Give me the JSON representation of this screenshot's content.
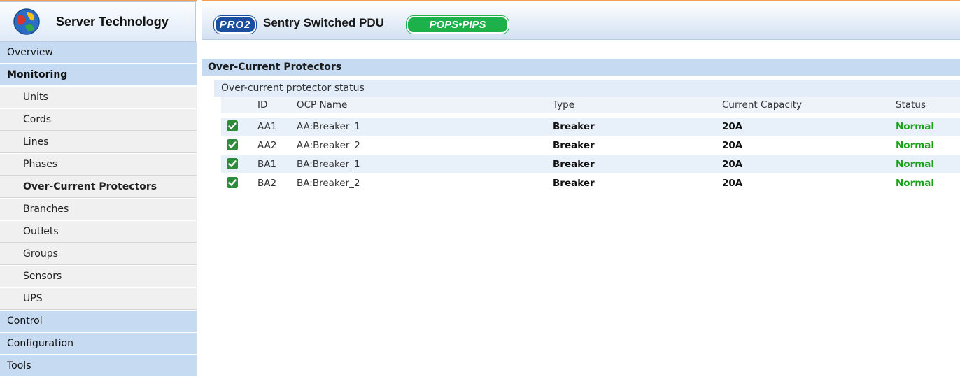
{
  "brand": {
    "name": "Server Technology"
  },
  "header": {
    "pro2_badge": "PRO2",
    "title": "Sentry Switched PDU",
    "pops_badge": "POPS•PIPS"
  },
  "sidebar": {
    "items": [
      {
        "label": "Overview",
        "level": "top"
      },
      {
        "label": "Monitoring",
        "level": "top"
      },
      {
        "label": "Units",
        "level": "sub"
      },
      {
        "label": "Cords",
        "level": "sub"
      },
      {
        "label": "Lines",
        "level": "sub"
      },
      {
        "label": "Phases",
        "level": "sub"
      },
      {
        "label": "Over-Current Protectors",
        "level": "sub",
        "active": true
      },
      {
        "label": "Branches",
        "level": "sub"
      },
      {
        "label": "Outlets",
        "level": "sub"
      },
      {
        "label": "Groups",
        "level": "sub"
      },
      {
        "label": "Sensors",
        "level": "sub"
      },
      {
        "label": "UPS",
        "level": "sub"
      },
      {
        "label": "Control",
        "level": "top"
      },
      {
        "label": "Configuration",
        "level": "top"
      },
      {
        "label": "Tools",
        "level": "top"
      }
    ]
  },
  "main": {
    "section_title": "Over-Current Protectors",
    "table_caption": "Over-current protector status",
    "columns": [
      "ID",
      "OCP Name",
      "Type",
      "Current Capacity",
      "Status"
    ],
    "rows": [
      {
        "checked": true,
        "id": "AA1",
        "name": "AA:Breaker_1",
        "type": "Breaker",
        "capacity": "20A",
        "status": "Normal"
      },
      {
        "checked": true,
        "id": "AA2",
        "name": "AA:Breaker_2",
        "type": "Breaker",
        "capacity": "20A",
        "status": "Normal"
      },
      {
        "checked": true,
        "id": "BA1",
        "name": "BA:Breaker_1",
        "type": "Breaker",
        "capacity": "20A",
        "status": "Normal"
      },
      {
        "checked": true,
        "id": "BA2",
        "name": "BA:Breaker_2",
        "type": "Breaker",
        "capacity": "20A",
        "status": "Normal"
      }
    ]
  },
  "colors": {
    "nav_top": "#c6daf1",
    "nav_sub": "#f0f0f0",
    "status_normal": "#1aa31a",
    "checkbox": "#2e8b3a",
    "frame": "#f0a050"
  }
}
